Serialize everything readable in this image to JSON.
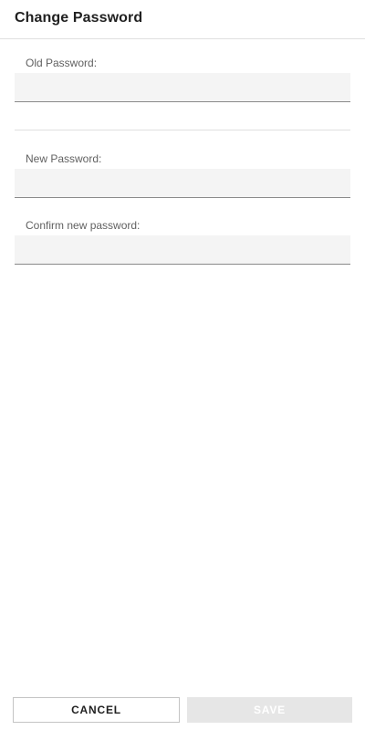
{
  "header": {
    "title": "Change Password"
  },
  "form": {
    "old_password": {
      "label": "Old Password:",
      "value": ""
    },
    "new_password": {
      "label": "New Password:",
      "value": ""
    },
    "confirm_password": {
      "label": "Confirm new password:",
      "value": ""
    }
  },
  "actions": {
    "cancel_label": "CANCEL",
    "save_label": "SAVE",
    "save_disabled": true
  },
  "colors": {
    "field_background": "#f4f4f4",
    "field_underline": "#8a8a8a",
    "save_disabled_background": "#e6e6e6"
  }
}
